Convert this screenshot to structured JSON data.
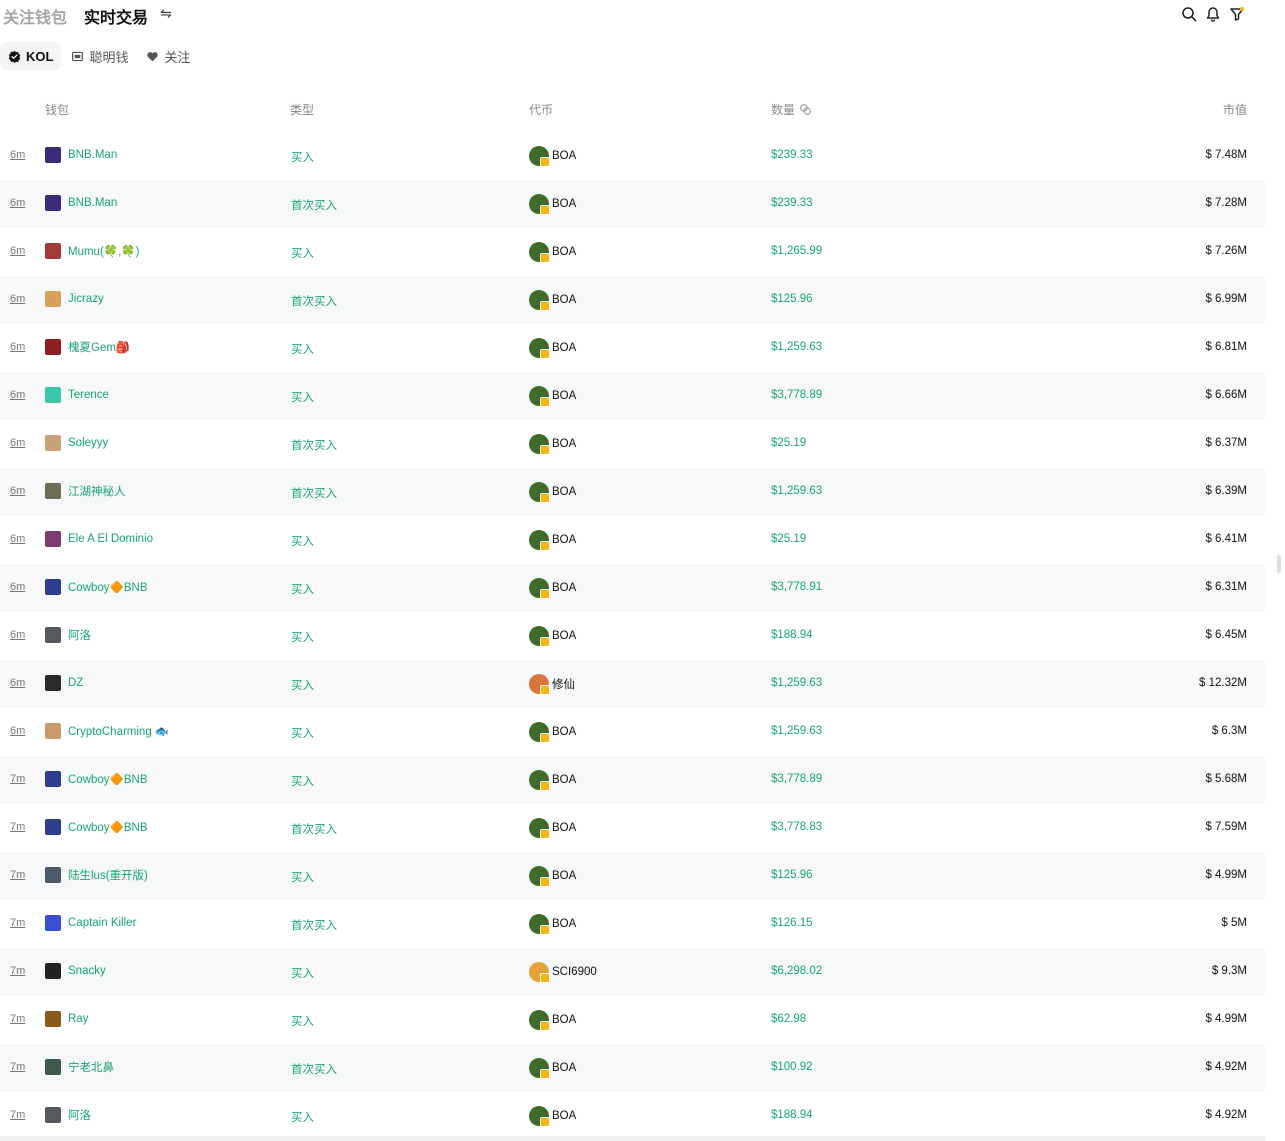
{
  "tabs": {
    "watch": "关注钱包",
    "live": "实时交易"
  },
  "filters": [
    {
      "label": "KOL"
    },
    {
      "label": "聪明钱"
    },
    {
      "label": "关注"
    }
  ],
  "columns": {
    "wallet": "钱包",
    "type": "类型",
    "token": "代币",
    "amount": "数量",
    "mcap": "市值"
  },
  "colors": {
    "green": "#17a673",
    "bnb": "#f0b90b"
  },
  "rows": [
    {
      "time": "6m",
      "wallet": "BNB.Man",
      "avatar": "#3b2a7a",
      "type": "买入",
      "token": "BOA",
      "token_color": "#3f6b2c",
      "amount": "$239.33",
      "mcap": "$ 7.48M"
    },
    {
      "time": "6m",
      "wallet": "BNB.Man",
      "avatar": "#3b2a7a",
      "type": "首次买入",
      "token": "BOA",
      "token_color": "#3f6b2c",
      "amount": "$239.33",
      "mcap": "$ 7.28M"
    },
    {
      "time": "6m",
      "wallet": "Mumu(🍀,🍀)",
      "avatar": "#a33a3a",
      "type": "买入",
      "token": "BOA",
      "token_color": "#3f6b2c",
      "amount": "$1,265.99",
      "mcap": "$ 7.26M"
    },
    {
      "time": "6m",
      "wallet": "Jicrazy",
      "avatar": "#d9a05b",
      "type": "首次买入",
      "token": "BOA",
      "token_color": "#3f6b2c",
      "amount": "$125.96",
      "mcap": "$ 6.99M"
    },
    {
      "time": "6m",
      "wallet": "槐夏Gem🎒",
      "avatar": "#8b1e1e",
      "type": "买入",
      "token": "BOA",
      "token_color": "#3f6b2c",
      "amount": "$1,259.63",
      "mcap": "$ 6.81M"
    },
    {
      "time": "6m",
      "wallet": "Terence",
      "avatar": "#3cc6a8",
      "type": "买入",
      "token": "BOA",
      "token_color": "#3f6b2c",
      "amount": "$3,778.89",
      "mcap": "$ 6.66M"
    },
    {
      "time": "6m",
      "wallet": "Soleyyy",
      "avatar": "#c9a27a",
      "type": "首次买入",
      "token": "BOA",
      "token_color": "#3f6b2c",
      "amount": "$25.19",
      "mcap": "$ 6.37M"
    },
    {
      "time": "6m",
      "wallet": "江湖神秘人",
      "avatar": "#6d6d55",
      "type": "首次买入",
      "token": "BOA",
      "token_color": "#3f6b2c",
      "amount": "$1,259.63",
      "mcap": "$ 6.39M"
    },
    {
      "time": "6m",
      "wallet": "Ele A El Dominio",
      "avatar": "#7a3d6d",
      "type": "买入",
      "token": "BOA",
      "token_color": "#3f6b2c",
      "amount": "$25.19",
      "mcap": "$ 6.41M"
    },
    {
      "time": "6m",
      "wallet": "Cowboy🔶BNB",
      "avatar": "#2d3f8c",
      "type": "买入",
      "token": "BOA",
      "token_color": "#3f6b2c",
      "amount": "$3,778.91",
      "mcap": "$ 6.31M"
    },
    {
      "time": "6m",
      "wallet": "阿洛",
      "avatar": "#555a60",
      "type": "买入",
      "token": "BOA",
      "token_color": "#3f6b2c",
      "amount": "$188.94",
      "mcap": "$ 6.45M"
    },
    {
      "time": "6m",
      "wallet": "DZ",
      "avatar": "#2a2a2a",
      "type": "买入",
      "token": "修仙",
      "token_color": "#d9743a",
      "amount": "$1,259.63",
      "mcap": "$ 12.32M"
    },
    {
      "time": "6m",
      "wallet": "CryptoCharming 🐟",
      "avatar": "#c99a6e",
      "type": "买入",
      "token": "BOA",
      "token_color": "#3f6b2c",
      "amount": "$1,259.63",
      "mcap": "$ 6.3M"
    },
    {
      "time": "7m",
      "wallet": "Cowboy🔶BNB",
      "avatar": "#2d3f8c",
      "type": "买入",
      "token": "BOA",
      "token_color": "#3f6b2c",
      "amount": "$3,778.89",
      "mcap": "$ 5.68M"
    },
    {
      "time": "7m",
      "wallet": "Cowboy🔶BNB",
      "avatar": "#2d3f8c",
      "type": "首次买入",
      "token": "BOA",
      "token_color": "#3f6b2c",
      "amount": "$3,778.83",
      "mcap": "$ 7.59M"
    },
    {
      "time": "7m",
      "wallet": "陆生lus(重开版)",
      "avatar": "#4a5a6a",
      "type": "买入",
      "token": "BOA",
      "token_color": "#3f6b2c",
      "amount": "$125.96",
      "mcap": "$ 4.99M"
    },
    {
      "time": "7m",
      "wallet": "Captain Killer",
      "avatar": "#3a4fd0",
      "type": "首次买入",
      "token": "BOA",
      "token_color": "#3f6b2c",
      "amount": "$126.15",
      "mcap": "$ 5M"
    },
    {
      "time": "7m",
      "wallet": "Snacky",
      "avatar": "#222222",
      "type": "买入",
      "token": "SCI6900",
      "token_color": "#e5a23a",
      "amount": "$6,298.02",
      "mcap": "$ 9.3M"
    },
    {
      "time": "7m",
      "wallet": "Ray",
      "avatar": "#8a5a1a",
      "type": "买入",
      "token": "BOA",
      "token_color": "#3f6b2c",
      "amount": "$62.98",
      "mcap": "$ 4.99M"
    },
    {
      "time": "7m",
      "wallet": "宁老北鼻",
      "avatar": "#3e5a4a",
      "type": "首次买入",
      "token": "BOA",
      "token_color": "#3f6b2c",
      "amount": "$100.92",
      "mcap": "$ 4.92M"
    },
    {
      "time": "7m",
      "wallet": "阿洛",
      "avatar": "#555a60",
      "type": "买入",
      "token": "BOA",
      "token_color": "#3f6b2c",
      "amount": "$188.94",
      "mcap": "$ 4.92M"
    }
  ]
}
